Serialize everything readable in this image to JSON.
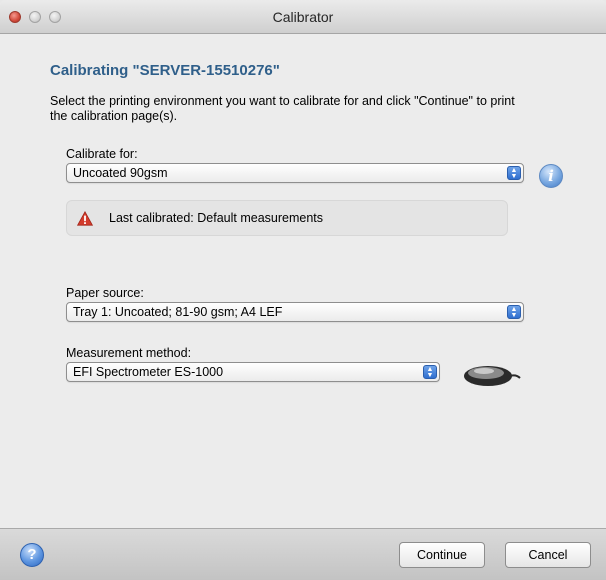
{
  "window": {
    "title": "Calibrator"
  },
  "heading": "Calibrating \"SERVER-15510276\"",
  "description": "Select the printing environment you want to calibrate for and click \"Continue\" to print the calibration page(s).",
  "calibrate_for": {
    "label": "Calibrate for:",
    "value": "Uncoated 90gsm"
  },
  "status": {
    "text": "Last calibrated: Default measurements",
    "icon": "warning-icon"
  },
  "paper_source": {
    "label": "Paper source:",
    "value": "Tray 1: Uncoated; 81-90 gsm; A4 LEF"
  },
  "measurement_method": {
    "label": "Measurement method:",
    "value": "EFI Spectrometer ES-1000"
  },
  "footer": {
    "continue_label": "Continue",
    "cancel_label": "Cancel"
  },
  "colors": {
    "heading": "#2f5f8a",
    "accent": "#2f6fd0",
    "warning": "#d33b2c"
  }
}
